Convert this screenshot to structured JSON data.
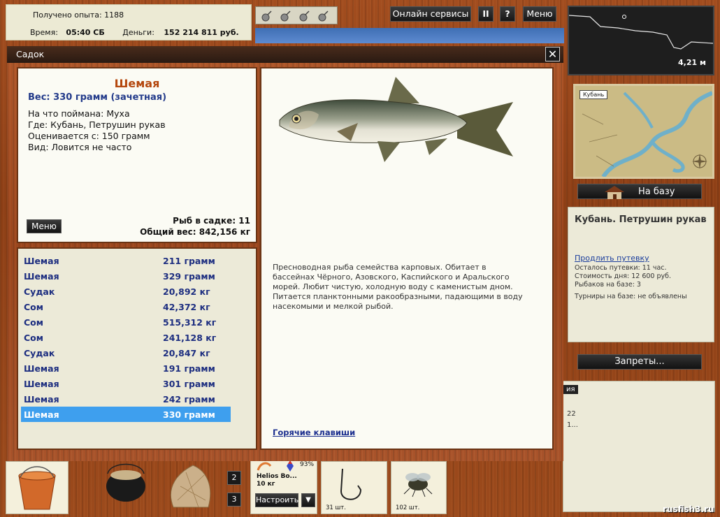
{
  "hud": {
    "experience": "Получено опыта: 1188",
    "time_label": "Время:",
    "time_value": "05:40 СБ",
    "money_label": "Деньги:",
    "money_value": "152 214 811 руб."
  },
  "toolbar": {
    "online_services": "Онлайн сервисы",
    "pause": "II",
    "help": "?",
    "menu": "Меню"
  },
  "depth": {
    "value": "4,21 м"
  },
  "map": {
    "label": "Кубань"
  },
  "base": {
    "to_base_button": "На базу",
    "location_title": "Кубань. Петрушин рукав",
    "extend_link": "Продлить путевку",
    "remaining": "Осталось путевки: 11 час.",
    "day_cost": "Стоимость дня: 12 600 руб.",
    "fishers": "Рыбаков на базе: 3",
    "tournaments": "Турниры на базе: не объявлены",
    "bans_button": "Запреты..."
  },
  "right_lower": {
    "tab_fragment": "ия",
    "value1": "22",
    "value2": "1..."
  },
  "dialog": {
    "title": "Садок",
    "close": "✕"
  },
  "fish_info": {
    "name": "Шемая",
    "weight": "Вес: 330 грамм (зачетная)",
    "caught_on": "На что поймана: Муха",
    "location": "Где: Кубань, Петрушин рукав",
    "rated_from": "Оценивается с: 150 грамм",
    "kind": "Вид: Ловится не часто",
    "menu_button": "Меню",
    "fish_count": "Рыб в садке: 11",
    "total_weight": "Общий вес: 842,156 кг"
  },
  "catch_list": [
    {
      "name": "Шемая",
      "weight": "211 грамм"
    },
    {
      "name": "Шемая",
      "weight": "329 грамм"
    },
    {
      "name": "Судак",
      "weight": "20,892 кг"
    },
    {
      "name": "Сом",
      "weight": "42,372 кг"
    },
    {
      "name": "Сом",
      "weight": "515,312 кг"
    },
    {
      "name": "Сом",
      "weight": "241,128 кг"
    },
    {
      "name": "Судак",
      "weight": "20,847 кг"
    },
    {
      "name": "Шемая",
      "weight": "191 грамм"
    },
    {
      "name": "Шемая",
      "weight": "301 грамм"
    },
    {
      "name": "Шемая",
      "weight": "242 грамм"
    },
    {
      "name": "Шемая",
      "weight": "330 грамм"
    }
  ],
  "selected_index": 10,
  "description": {
    "text": "Пресноводная рыба семейства карповых. Обитает в бассейнах Чёрного, Азовского, Каспийского и Аральского морей. Любит чистую, холодную воду с каменистым дном. Питается планктонными ракообразными, падающими в воду насекомыми и мелкой рыбой.",
    "hotkeys_link": "Горячие клавиши"
  },
  "bottom_bar": {
    "slot2": "2",
    "slot3": "3",
    "rod_percent": "93%",
    "rod_name": "Helios Bo...",
    "rod_weight": "10 кг",
    "configure_button": "Настроить",
    "dropdown": "▼",
    "hook_count": "31 шт.",
    "fly_count": "102 шт."
  },
  "credit": "rusfish3.ru",
  "colors": {
    "accent_selected": "#3e9fee",
    "fish_name": "#b4470d",
    "list_text": "#1d2e80"
  }
}
